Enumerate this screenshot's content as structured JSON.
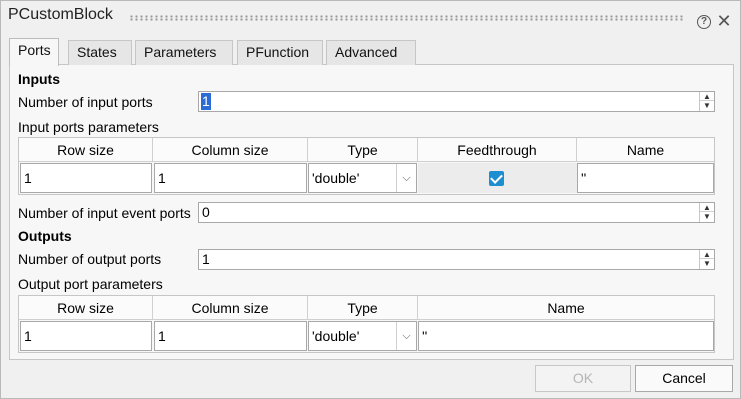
{
  "window": {
    "title": "PCustomBlock"
  },
  "tabs": [
    {
      "label": "Ports"
    },
    {
      "label": "States"
    },
    {
      "label": "Parameters"
    },
    {
      "label": "PFunction"
    },
    {
      "label": "Advanced"
    }
  ],
  "inputs": {
    "heading": "Inputs",
    "num_ports_label": "Number of input ports",
    "num_ports_value": "1",
    "params_label": "Input ports parameters",
    "columns": [
      "Row size",
      "Column size",
      "Type",
      "Feedthrough",
      "Name"
    ],
    "row": {
      "row_size": "1",
      "column_size": "1",
      "type": "'double'",
      "feedthrough": true,
      "name": "''"
    },
    "num_event_ports_label": "Number of input event ports",
    "num_event_ports_value": "0"
  },
  "outputs": {
    "heading": "Outputs",
    "num_ports_label": "Number of output ports",
    "num_ports_value": "1",
    "params_label": "Output port parameters",
    "columns": [
      "Row size",
      "Column size",
      "Type",
      "Name"
    ],
    "row": {
      "row_size": "1",
      "column_size": "1",
      "type": "'double'",
      "name": "''"
    }
  },
  "buttons": {
    "ok": "OK",
    "cancel": "Cancel"
  },
  "colors": {
    "selection": "#2c6cd6",
    "checkbox": "#1d8fd0"
  }
}
